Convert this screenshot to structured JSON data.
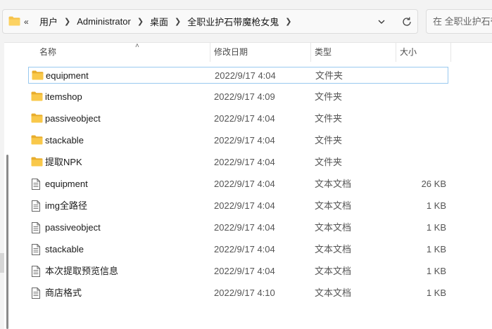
{
  "address": {
    "overflow": "«",
    "crumbs": [
      "用户",
      "Administrator",
      "桌面",
      "全职业护石带魔枪女鬼"
    ]
  },
  "search": {
    "placeholder": "在 全职业护石带魔枪女鬼 中搜索",
    "shown_text": "在 全职业护石带"
  },
  "columns": {
    "name": "名称",
    "date": "修改日期",
    "type": "类型",
    "size": "大小"
  },
  "colors": {
    "folder": "#f6c34a",
    "selection_border": "#99c9ef"
  },
  "files": [
    {
      "name": "equipment",
      "date": "2022/9/17 4:04",
      "type": "文件夹",
      "size": "",
      "icon": "folder-icon",
      "selected": true
    },
    {
      "name": "itemshop",
      "date": "2022/9/17 4:09",
      "type": "文件夹",
      "size": "",
      "icon": "folder-icon"
    },
    {
      "name": "passiveobject",
      "date": "2022/9/17 4:04",
      "type": "文件夹",
      "size": "",
      "icon": "folder-icon"
    },
    {
      "name": "stackable",
      "date": "2022/9/17 4:04",
      "type": "文件夹",
      "size": "",
      "icon": "folder-icon"
    },
    {
      "name": "提取NPK",
      "date": "2022/9/17 4:04",
      "type": "文件夹",
      "size": "",
      "icon": "folder-icon"
    },
    {
      "name": "equipment",
      "date": "2022/9/17 4:04",
      "type": "文本文档",
      "size": "26 KB",
      "icon": "text-document-icon"
    },
    {
      "name": "img全路径",
      "date": "2022/9/17 4:04",
      "type": "文本文档",
      "size": "1 KB",
      "icon": "text-document-icon"
    },
    {
      "name": "passiveobject",
      "date": "2022/9/17 4:04",
      "type": "文本文档",
      "size": "1 KB",
      "icon": "text-document-icon"
    },
    {
      "name": "stackable",
      "date": "2022/9/17 4:04",
      "type": "文本文档",
      "size": "1 KB",
      "icon": "text-document-icon"
    },
    {
      "name": "本次提取预览信息",
      "date": "2022/9/17 4:04",
      "type": "文本文档",
      "size": "1 KB",
      "icon": "text-document-icon"
    },
    {
      "name": "商店格式",
      "date": "2022/9/17 4:10",
      "type": "文本文档",
      "size": "1 KB",
      "icon": "text-document-icon"
    }
  ]
}
